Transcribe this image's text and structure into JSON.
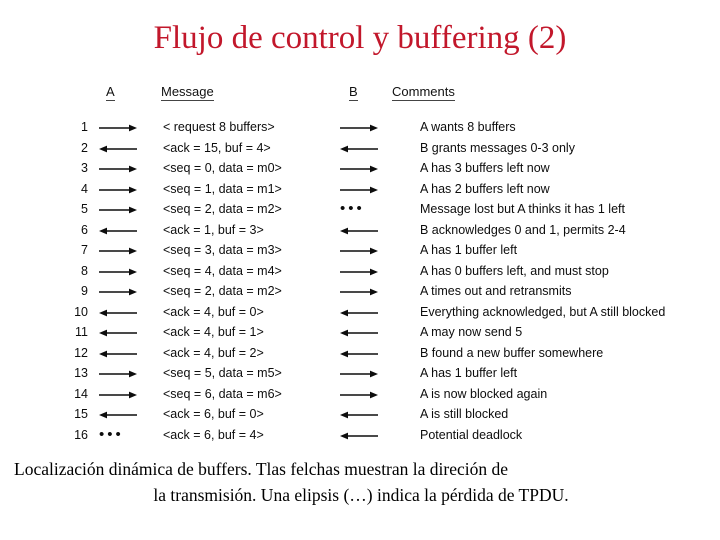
{
  "title": "Flujo de control y buffering (2)",
  "accent_color": "#c2172b",
  "text_color": "#0d0d0d",
  "table": {
    "headers": {
      "num": "",
      "a": "A",
      "message": "Message",
      "b": "B",
      "comments": "Comments"
    },
    "rows": [
      {
        "num": "1",
        "a": "arrow-right",
        "message": "< request 8 buffers>",
        "b": "arrow-right",
        "comment": "A wants 8 buffers"
      },
      {
        "num": "2",
        "a": "arrow-left",
        "message": "<ack = 15, buf = 4>",
        "b": "arrow-left",
        "comment": "B grants messages 0-3 only"
      },
      {
        "num": "3",
        "a": "arrow-right",
        "message": "<seq = 0, data = m0>",
        "b": "arrow-right",
        "comment": "A has 3 buffers left now"
      },
      {
        "num": "4",
        "a": "arrow-right",
        "message": "<seq = 1, data = m1>",
        "b": "arrow-right",
        "comment": "A has 2 buffers left now"
      },
      {
        "num": "5",
        "a": "arrow-right",
        "message": "<seq = 2, data = m2>",
        "b": "ellipsis",
        "comment": "Message lost but A thinks it has 1 left"
      },
      {
        "num": "6",
        "a": "arrow-left",
        "message": "<ack = 1, buf = 3>",
        "b": "arrow-left",
        "comment": "B acknowledges 0 and 1, permits 2-4"
      },
      {
        "num": "7",
        "a": "arrow-right",
        "message": "<seq = 3, data = m3>",
        "b": "arrow-right",
        "comment": "A has 1 buffer left"
      },
      {
        "num": "8",
        "a": "arrow-right",
        "message": "<seq = 4, data = m4>",
        "b": "arrow-right",
        "comment": "A has 0 buffers left, and must stop"
      },
      {
        "num": "9",
        "a": "arrow-right",
        "message": "<seq = 2, data = m2>",
        "b": "arrow-right",
        "comment": "A times out and retransmits"
      },
      {
        "num": "10",
        "a": "arrow-left",
        "message": "<ack = 4, buf = 0>",
        "b": "arrow-left",
        "comment": "Everything acknowledged, but A still blocked"
      },
      {
        "num": "11",
        "a": "arrow-left",
        "message": "<ack = 4, buf = 1>",
        "b": "arrow-left",
        "comment": "A may now send 5"
      },
      {
        "num": "12",
        "a": "arrow-left",
        "message": "<ack = 4, buf = 2>",
        "b": "arrow-left",
        "comment": "B found a new buffer somewhere"
      },
      {
        "num": "13",
        "a": "arrow-right",
        "message": "<seq = 5, data = m5>",
        "b": "arrow-right",
        "comment": "A has 1 buffer left"
      },
      {
        "num": "14",
        "a": "arrow-right",
        "message": "<seq = 6, data = m6>",
        "b": "arrow-right",
        "comment": "A is now blocked again"
      },
      {
        "num": "15",
        "a": "arrow-left",
        "message": "<ack = 6, buf = 0>",
        "b": "arrow-left",
        "comment": "A is still blocked"
      },
      {
        "num": "16",
        "a": "ellipsis",
        "message": "<ack = 6, buf = 4>",
        "b": "arrow-left",
        "comment": "Potential deadlock"
      }
    ],
    "ellipsis_glyph": "•••"
  },
  "caption": {
    "line1": "Localización dinámica de buffers.  Tlas felchas muestran la direción de",
    "line2": "la transmisión.  Una elipsis (…) indica la pérdida de TPDU."
  }
}
